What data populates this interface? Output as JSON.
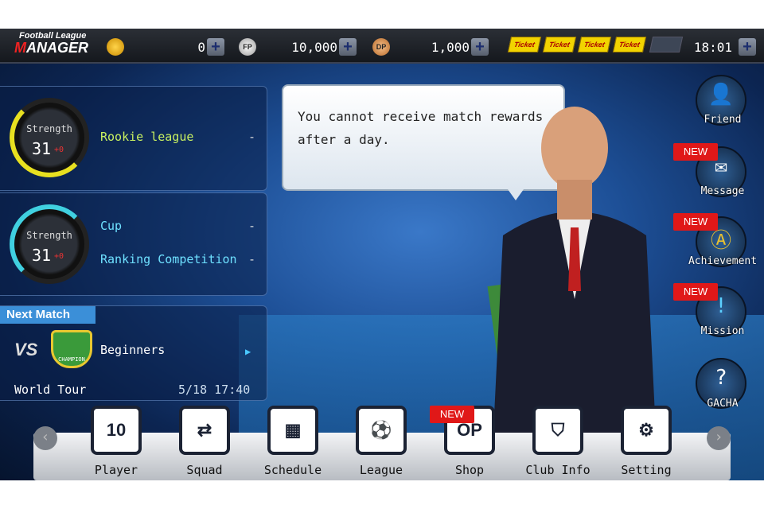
{
  "header": {
    "logo_line1": "Football League",
    "logo_line2": "MANAGER",
    "gold": "0",
    "fp": "10,000",
    "dp": "1,000",
    "fp_label": "FP",
    "dp_label": "DP",
    "ticket_label": "Ticket",
    "tickets_filled": 4,
    "tickets_total": 5,
    "time": "18:01",
    "plus": "+"
  },
  "league_panel": {
    "strength_label": "Strength",
    "strength": "31",
    "delta": "+0",
    "league": "Rookie league",
    "value": "-"
  },
  "cup_panel": {
    "strength_label": "Strength",
    "strength": "31",
    "delta": "+0",
    "cup": "Cup",
    "cup_value": "-",
    "ranking": "Ranking Competition",
    "ranking_value": "-"
  },
  "next_match": {
    "title": "Next Match",
    "vs": "VS",
    "badge": "CHAMPION",
    "opponent": "Beginners",
    "mode": "World Tour",
    "datetime": "5/18 17:40"
  },
  "bubble": {
    "text": "You cannot receive match rewards after a day."
  },
  "side_buttons": [
    {
      "label": "Friend",
      "icon": "add-friend-icon",
      "new": false
    },
    {
      "label": "Message",
      "icon": "envelope-icon",
      "new": true
    },
    {
      "label": "Achievement",
      "icon": "medal-icon",
      "new": true
    },
    {
      "label": "Mission",
      "icon": "exclamation-icon",
      "new": true
    },
    {
      "label": "GACHA",
      "icon": "gacha-box-icon",
      "new": false
    }
  ],
  "new_label": "NEW",
  "dock": [
    {
      "label": "Player",
      "icon": "jersey-icon",
      "glyph": "10"
    },
    {
      "label": "Squad",
      "icon": "squad-swap-icon",
      "glyph": "⇄"
    },
    {
      "label": "Schedule",
      "icon": "calendar-icon",
      "glyph": "▦"
    },
    {
      "label": "League",
      "icon": "ball-boot-icon",
      "glyph": "⚽"
    },
    {
      "label": "Shop",
      "icon": "shop-icon",
      "glyph": "OP"
    },
    {
      "label": "Club Info",
      "icon": "shield-doc-icon",
      "glyph": "⛉"
    },
    {
      "label": "Setting",
      "icon": "gears-icon",
      "glyph": "⚙"
    }
  ],
  "colors": {
    "league_text": "#c8f060",
    "cup_text": "#6ee0ff",
    "accent_new": "#e01818"
  }
}
